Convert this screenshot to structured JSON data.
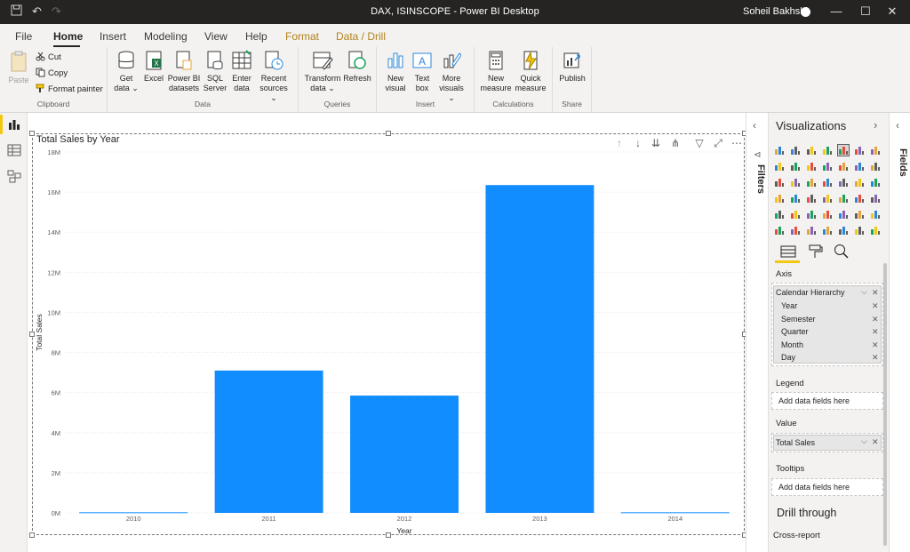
{
  "window": {
    "title": "DAX, ISINSCOPE - Power BI Desktop",
    "user": "Soheil Bakhshi"
  },
  "ribbon_tabs": [
    "File",
    "Home",
    "Insert",
    "Modeling",
    "View",
    "Help",
    "Format",
    "Data / Drill"
  ],
  "clipboard": {
    "paste": "Paste",
    "cut": "Cut",
    "copy": "Copy",
    "format_painter": "Format painter",
    "label": "Clipboard"
  },
  "data_group": {
    "get_data": [
      "Get",
      "data"
    ],
    "excel": "Excel",
    "pbi_datasets": [
      "Power BI",
      "datasets"
    ],
    "sql": [
      "SQL",
      "Server"
    ],
    "enter": [
      "Enter",
      "data"
    ],
    "recent": [
      "Recent",
      "sources"
    ],
    "label": "Data"
  },
  "queries": {
    "transform": [
      "Transform",
      "data"
    ],
    "refresh": "Refresh",
    "label": "Queries"
  },
  "insert": {
    "new_visual": [
      "New",
      "visual"
    ],
    "text_box": [
      "Text",
      "box"
    ],
    "more_visuals": [
      "More",
      "visuals"
    ],
    "label": "Insert"
  },
  "calculations": {
    "new_measure": [
      "New",
      "measure"
    ],
    "quick_measure": [
      "Quick",
      "measure"
    ],
    "label": "Calculations"
  },
  "share": {
    "publish": "Publish",
    "label": "Share"
  },
  "visual_title": "Total Sales by Year",
  "filters_label": "Filters",
  "fields_label": "Fields",
  "visualizations": {
    "title": "Visualizations",
    "axis_label": "Axis",
    "axis_field": "Calendar Hierarchy",
    "axis_levels": [
      "Year",
      "Semester",
      "Quarter",
      "Month",
      "Day"
    ],
    "legend_label": "Legend",
    "legend_placeholder": "Add data fields here",
    "value_label": "Value",
    "value_field": "Total Sales",
    "tooltips_label": "Tooltips",
    "tooltips_placeholder": "Add data fields here",
    "drill_through": "Drill through",
    "cross_report": "Cross-report"
  },
  "colors": {
    "bar": "#118dff",
    "accent": "#f2c811",
    "titlebar": "#252423"
  },
  "chart_data": {
    "type": "bar",
    "title": "Total Sales by Year",
    "xlabel": "Year",
    "ylabel": "Total Sales",
    "categories": [
      "2010",
      "2011",
      "2012",
      "2013",
      "2014"
    ],
    "values": [
      0.03,
      7.1,
      5.85,
      16.35,
      0.03
    ],
    "value_unit": "M",
    "ylim": [
      0,
      18
    ],
    "yticks": [
      "0M",
      "2M",
      "4M",
      "6M",
      "8M",
      "10M",
      "12M",
      "14M",
      "16M",
      "18M"
    ],
    "grid": true
  }
}
